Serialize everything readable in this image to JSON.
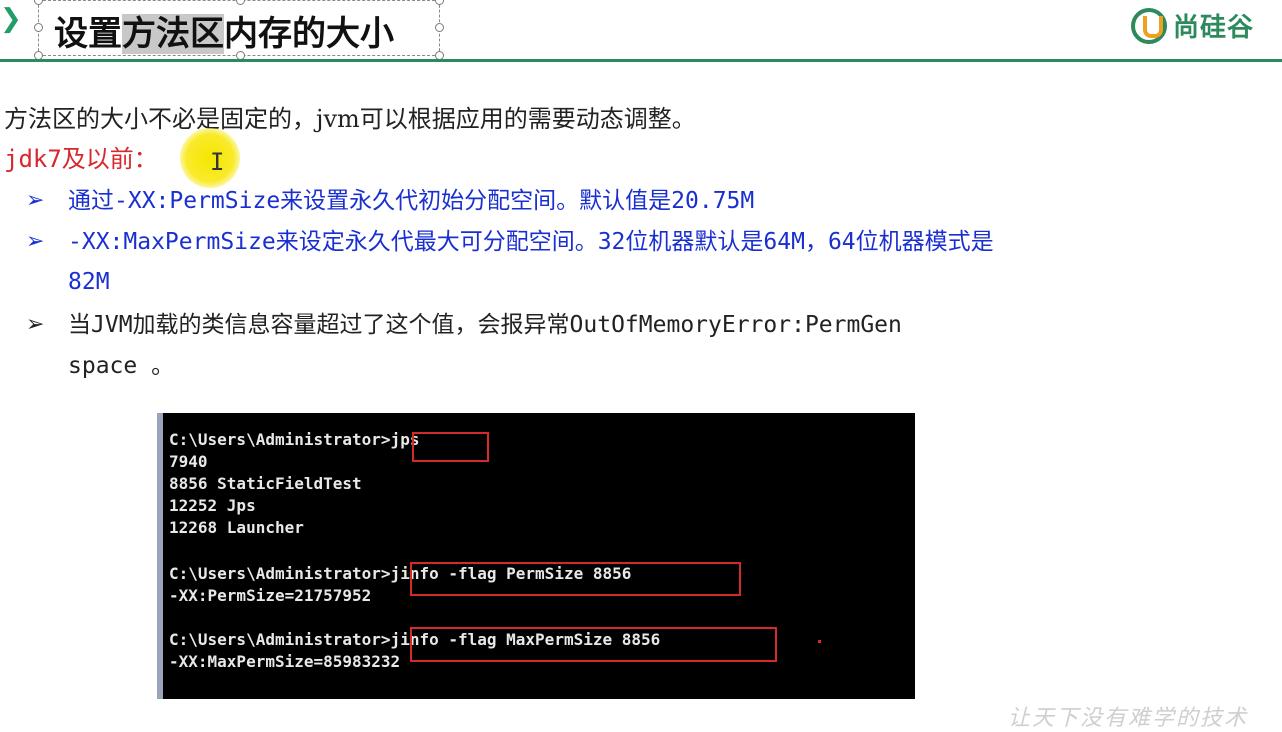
{
  "header": {
    "title_parts": [
      "设置",
      "方法区",
      "内存的大小"
    ],
    "brand_name": "尚硅谷",
    "accent_color": "#2d8a5c"
  },
  "content": {
    "intro": "方法区的大小不必是固定的，jvm可以根据应用的需要动态调整。",
    "jdk_label": "jdk7及以前：",
    "bullets": [
      {
        "text": "通过-XX:PermSize来设置永久代初始分配空间。默认值是20.75M",
        "color": "#1a2fd1"
      },
      {
        "text": "-XX:MaxPermSize来设定永久代最大可分配空间。32位机器默认是64M，64位机器模式是",
        "text_cont": "82M",
        "color": "#1a2fd1"
      },
      {
        "text": "当JVM加载的类信息容量超过了这个值，会报异常OutOfMemoryError:PermGen",
        "text_cont": "space 。",
        "color": "#222222"
      }
    ],
    "arrow_glyph": "➢"
  },
  "terminal": {
    "lines": [
      "C:\\Users\\Administrator>jps",
      "7940",
      "8856 StaticFieldTest",
      "12252 Jps",
      "12268 Launcher",
      "",
      "C:\\Users\\Administrator>jinfo -flag PermSize 8856",
      "-XX:PermSize=21757952",
      "",
      "C:\\Users\\Administrator>jinfo -flag MaxPermSize 8856",
      "-XX:MaxPermSize=85983232"
    ]
  },
  "watermark": "让天下没有难学的技术"
}
